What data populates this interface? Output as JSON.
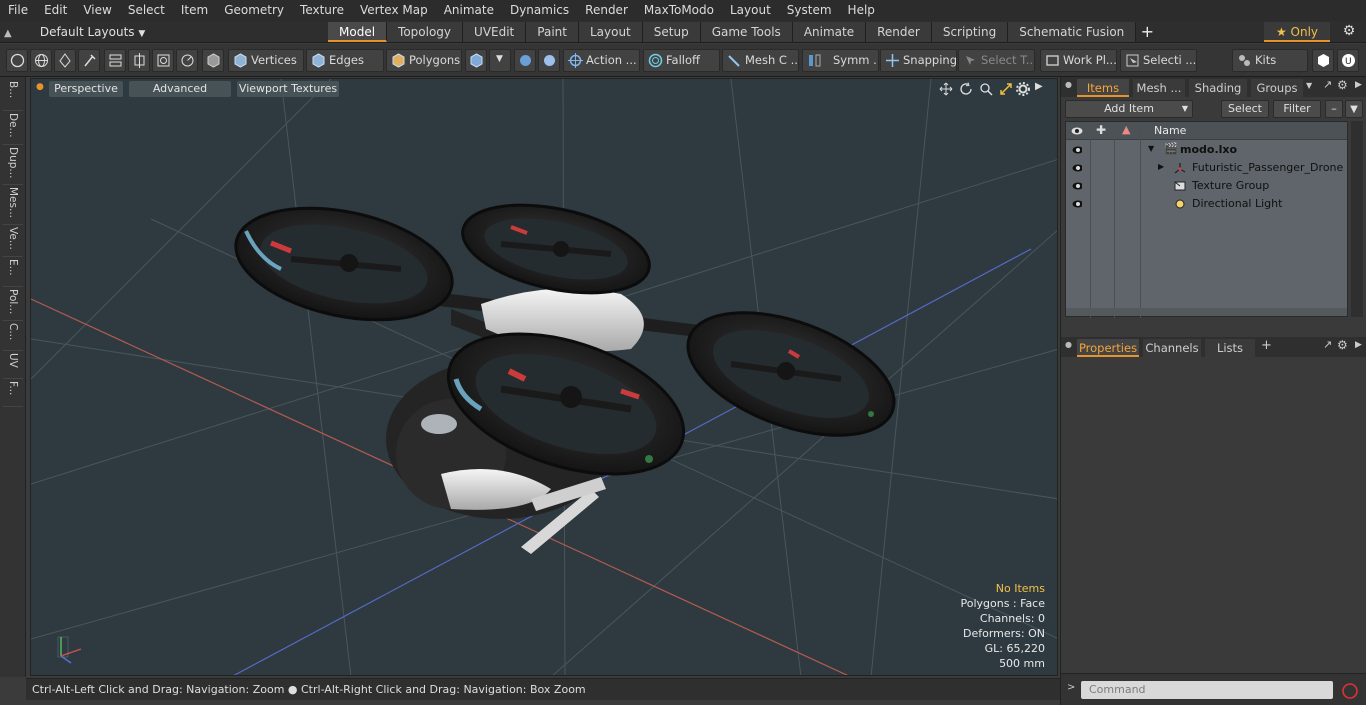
{
  "menu": [
    "File",
    "Edit",
    "View",
    "Select",
    "Item",
    "Geometry",
    "Texture",
    "Vertex Map",
    "Animate",
    "Dynamics",
    "Render",
    "MaxToModo",
    "Layout",
    "System",
    "Help"
  ],
  "layout_selector": "Default Layouts",
  "mode_tabs": [
    "Model",
    "Topology",
    "UVEdit",
    "Paint",
    "Layout",
    "Setup",
    "Game Tools",
    "Animate",
    "Render",
    "Scripting",
    "Schematic Fusion"
  ],
  "active_tab": "Model",
  "only_label": "Only",
  "toolbar": {
    "vertices": "Vertices",
    "edges": "Edges",
    "polygons": "Polygons",
    "action": "Action ...",
    "falloff": "Falloff",
    "mesh": "Mesh C ...",
    "symmetry": "Symm ...",
    "snapping": "Snapping",
    "select_t": "Select T...",
    "workplane": "Work Pl...",
    "selection": "Selecti ...",
    "kits": "Kits"
  },
  "left_tabs": [
    "B...",
    "De...",
    "Dup...",
    "Mes...",
    "Ve...",
    "E...",
    "Pol...",
    "C...",
    "UV",
    "F..."
  ],
  "viewport": {
    "perspective": "Perspective",
    "advanced": "Advanced",
    "textures": "Viewport Textures",
    "info": {
      "no_items": "No Items",
      "polygons": "Polygons : Face",
      "channels": "Channels: 0",
      "deformers": "Deformers: ON",
      "gl": "GL: 65,220",
      "scale": "500 mm"
    },
    "colors": {
      "no_items": "#f2c14a",
      "background": "#2e3a3f"
    }
  },
  "status_text": "Ctrl-Alt-Left Click and Drag: Navigation: Zoom ● Ctrl-Alt-Right Click and Drag: Navigation: Box Zoom",
  "items_panel": {
    "tabs": [
      "Items",
      "Mesh ...",
      "Shading",
      "Groups"
    ],
    "active": "Items",
    "add_item": "Add Item",
    "select": "Select",
    "filter": "Filter",
    "name_header": "Name",
    "tree": [
      {
        "label": "modo.lxo",
        "icon": "scene-icon"
      },
      {
        "label": "Futuristic_Passenger_Drone",
        "icon": "mesh-icon"
      },
      {
        "label": "Texture Group",
        "icon": "texture-icon"
      },
      {
        "label": "Directional Light",
        "icon": "light-icon"
      }
    ]
  },
  "properties_panel": {
    "tabs": [
      "Properties",
      "Channels",
      "Lists"
    ],
    "active": "Properties"
  },
  "command_placeholder": "Command"
}
